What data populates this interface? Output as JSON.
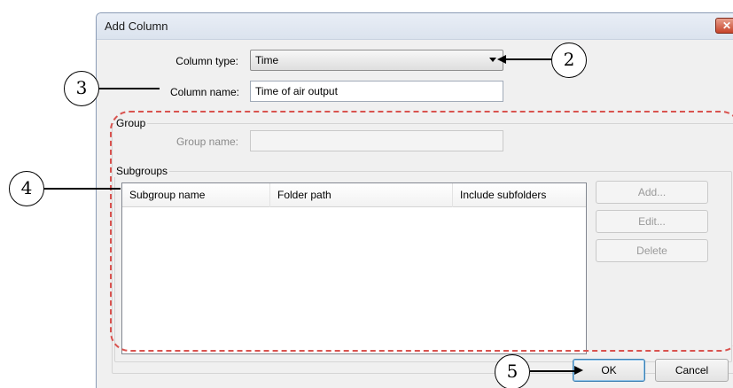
{
  "window": {
    "title": "Add Column",
    "close_glyph": "✕"
  },
  "form": {
    "column_type_label": "Column type:",
    "column_type_value": "Time",
    "column_name_label": "Column name:",
    "column_name_value": "Time of air output"
  },
  "group": {
    "title": "Group",
    "group_name_label": "Group name:",
    "group_name_value": ""
  },
  "subgroups": {
    "title": "Subgroups",
    "columns": [
      "Subgroup name",
      "Folder path",
      "Include subfolders"
    ],
    "buttons": {
      "add": "Add...",
      "edit": "Edit...",
      "delete": "Delete"
    }
  },
  "footer": {
    "ok": "OK",
    "cancel": "Cancel"
  },
  "callouts": {
    "c2": "2",
    "c3": "3",
    "c4": "4",
    "c5": "5"
  },
  "colors": {
    "annotation_dash": "#d9534f",
    "default_button_border": "#3c7fb1"
  }
}
